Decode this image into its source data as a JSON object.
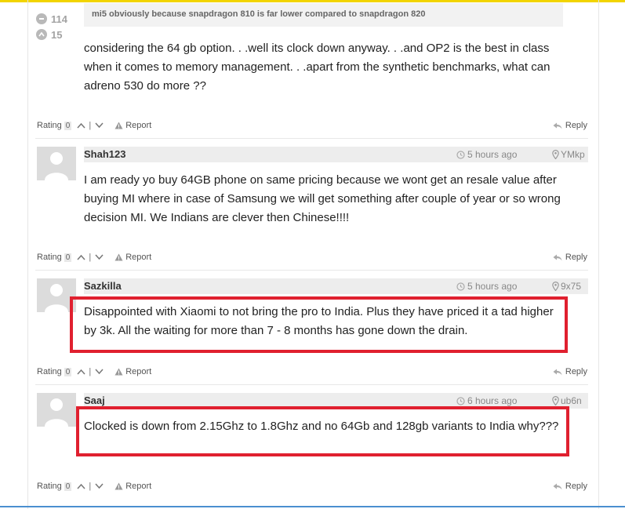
{
  "colors": {
    "accent": "#f2d400",
    "highlight": "#e0202f",
    "link": "#4a8fd0"
  },
  "parent_comment": {
    "votes": {
      "down": "114",
      "up": "15"
    },
    "quote": "mi5 obviously because snapdragon 810 is far lower compared to snapdragon 820",
    "text": "considering the 64 gb option. . .well its clock down anyway. . .and OP2 is the best in class when it comes to memory management. . .apart from the synthetic benchmarks, what can adreno 530 do more ??"
  },
  "actions": {
    "rating_label": "Rating",
    "rating_value": "0",
    "separator": "|",
    "report_label": "Report",
    "reply_label": "Reply"
  },
  "comments": [
    {
      "author": "Shah123",
      "time": "5 hours ago",
      "location": "YMkp",
      "text": "I am ready yo buy 64GB phone on same pricing because we wont get an resale value after buying MI where in case of Samsung we will get something after couple of year or so wrong decision MI. We Indians are clever then Chinese!!!!"
    },
    {
      "author": "Sazkilla",
      "time": "5 hours ago",
      "location": "9x75",
      "text": "Disappointed with Xiaomi to not bring the pro to India. Plus they have priced it a tad higher by 3k. All the waiting for more than 7 - 8 months has gone down the drain."
    },
    {
      "author": "Saaj",
      "time": "6 hours ago",
      "location": "ub6n",
      "text": "Clocked is down from 2.15Ghz to 1.8Ghz and no 64Gb and 128gb variants to India why???"
    }
  ]
}
